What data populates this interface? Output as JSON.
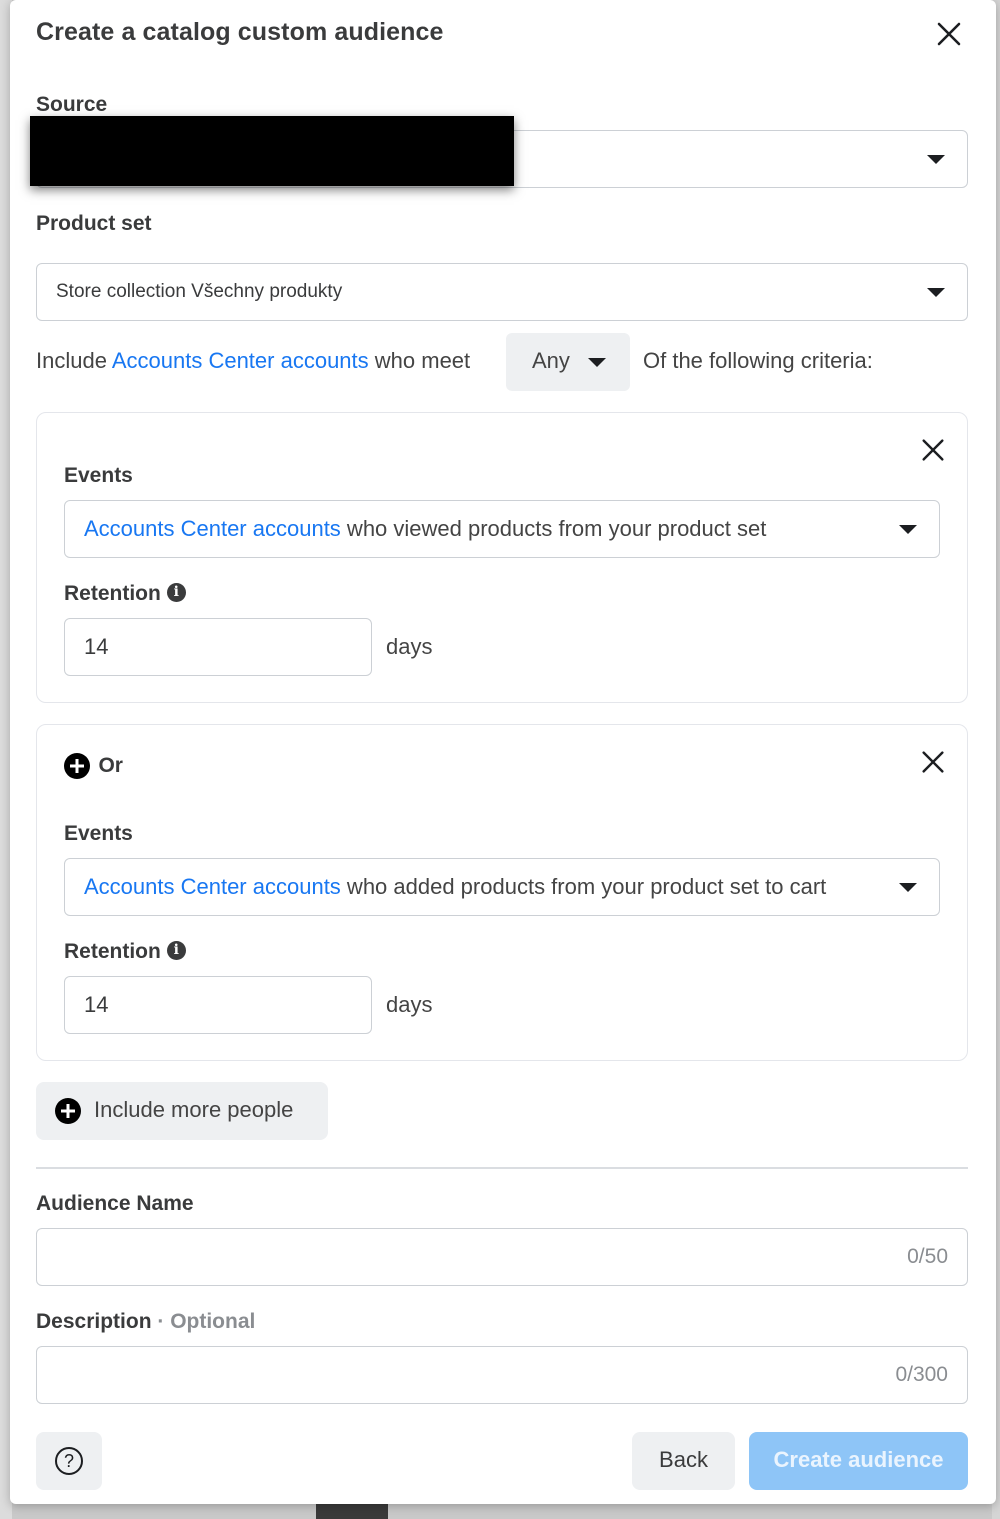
{
  "dialog": {
    "title": "Create a catalog custom audience"
  },
  "source": {
    "label": "Source"
  },
  "product_set": {
    "label": "Product set",
    "selected": "Store collection Všechny produkty"
  },
  "include_row": {
    "prefix": "Include ",
    "link": "Accounts Center accounts",
    "middle": " who meet",
    "any_value": "Any",
    "suffix": "Of the following criteria:"
  },
  "criteria": [
    {
      "events_label": "Events",
      "event_link": "Accounts Center accounts",
      "event_text": " who viewed products from your product set",
      "retention_label": "Retention",
      "retention_value": "14",
      "unit": "days"
    },
    {
      "or_label": "Or",
      "events_label": "Events",
      "event_link": "Accounts Center accounts",
      "event_text": " who added products from your product set to cart",
      "retention_label": "Retention",
      "retention_value": "14",
      "unit": "days"
    }
  ],
  "include_more": {
    "label": "Include more people"
  },
  "audience_name": {
    "label": "Audience Name",
    "value": "",
    "counter": "0/50"
  },
  "description": {
    "label": "Description",
    "optional": " · Optional",
    "value": "",
    "counter": "0/300"
  },
  "footer": {
    "help_glyph": "?",
    "back_label": "Back",
    "create_label": "Create audience"
  },
  "colors": {
    "link": "#1877f2",
    "primary_disabled": "#8ec5f7"
  }
}
